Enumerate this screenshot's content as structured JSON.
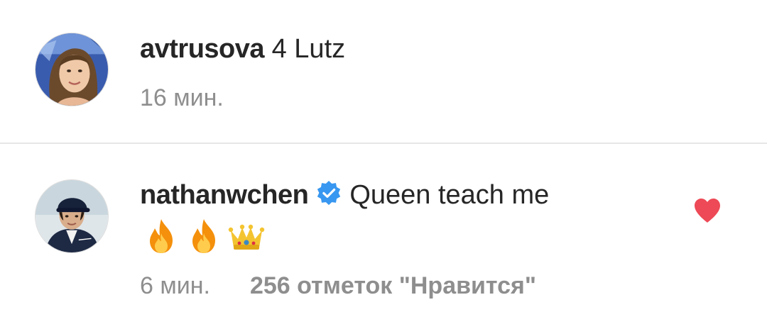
{
  "comments": [
    {
      "username": "avtrusova",
      "text": "4 Lutz",
      "time": "16 мин.",
      "verified": false
    },
    {
      "username": "nathanwchen",
      "text": "Queen teach me",
      "emojis": [
        "fire-emoji",
        "fire-emoji",
        "crown-emoji"
      ],
      "time": "6 мин.",
      "likes": "256 отметок \"Нравится\"",
      "verified": true,
      "liked": true
    }
  ],
  "colors": {
    "text": "#262626",
    "meta": "#8e8e8e",
    "verified": "#3897f0",
    "heart": "#ed4956",
    "divider": "#e6e6e6"
  }
}
